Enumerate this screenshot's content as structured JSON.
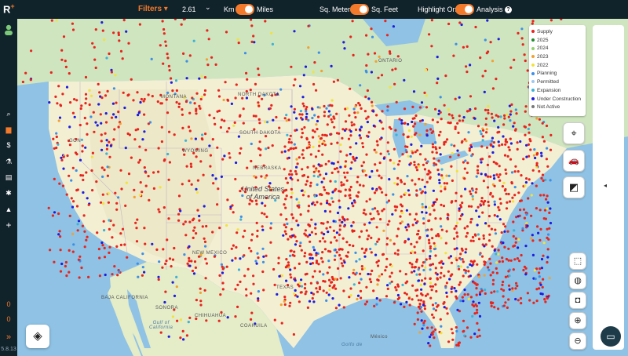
{
  "app": {
    "logo": "R",
    "logo_sup": "+",
    "version": "5.8.13"
  },
  "topbar": {
    "filters_label": "Filters",
    "filters_caret": "▾",
    "distance_value": "2.61",
    "distance_caret": "⌄",
    "km_label": "Km",
    "miles_label": "Miles",
    "sqm_label": "Sq. Meters",
    "sqft_label": "Sq. Feet",
    "highlight_label": "Highlight Only",
    "analysis_label": "Analysis",
    "help_glyph": "?"
  },
  "sidebar": {
    "icons": [
      "user-icon",
      "search-icon",
      "chart-icon",
      "dollar-icon",
      "flask-icon",
      "document-icon",
      "gear-icon",
      "bell-icon",
      "plus-icon"
    ],
    "glyphs": {
      "search": "⌕",
      "chart": "▆",
      "dollar": "$",
      "flask": "⚗",
      "document": "▤",
      "gear": "✱",
      "bell": "▲",
      "plus": "+",
      "expand": "»"
    },
    "counter_top": "0",
    "counter_bottom": "0"
  },
  "legend": {
    "items": [
      {
        "label": "Supply",
        "color": "#e8231c"
      },
      {
        "label": "2025",
        "color": "#1f8a2e"
      },
      {
        "label": "2024",
        "color": "#8fd36a"
      },
      {
        "label": "2023",
        "color": "#f2a130"
      },
      {
        "label": "2022",
        "color": "#f3e23a"
      },
      {
        "label": "Planning",
        "color": "#3b8fe8"
      },
      {
        "label": "Permitted",
        "color": "#9cc8ef"
      },
      {
        "label": "Expansion",
        "color": "#3cb2d8"
      },
      {
        "label": "Under Construction",
        "color": "#1c1ce0"
      },
      {
        "label": "Not Active",
        "color": "#777777"
      }
    ]
  },
  "map": {
    "labels": {
      "ontario": "ONTARIO",
      "montana": "MONTANA",
      "north_dakota": "NORTH DAKOTA",
      "south_dakota": "SOUTH DAKOTA",
      "wyoming": "WYOMING",
      "nebraska": "NEBRASKA",
      "gon": "GON",
      "new_mexico": "NEW MEXICO",
      "texas": "TEXAS",
      "baja": "BAJA CALIFORNIA",
      "sonora": "SONORA",
      "chihuahua": "CHIHUAHUA",
      "coahuila": "COAHUILA",
      "usa_line1": "United States",
      "usa_line2": "of America",
      "gulf_ca_1": "Gulf of",
      "gulf_ca_2": "California",
      "gulf_mex": "Golfo de",
      "mexico_city": "México"
    }
  },
  "tools": {
    "locate": "⌖",
    "car": "🚗",
    "ruler": "◩",
    "select": "⬚",
    "globe": "◍",
    "fit": "◘",
    "zoom_in": "⊕",
    "zoom_out": "⊖",
    "layers": "◈",
    "chat": "▭",
    "panel_arrow": "◂"
  }
}
